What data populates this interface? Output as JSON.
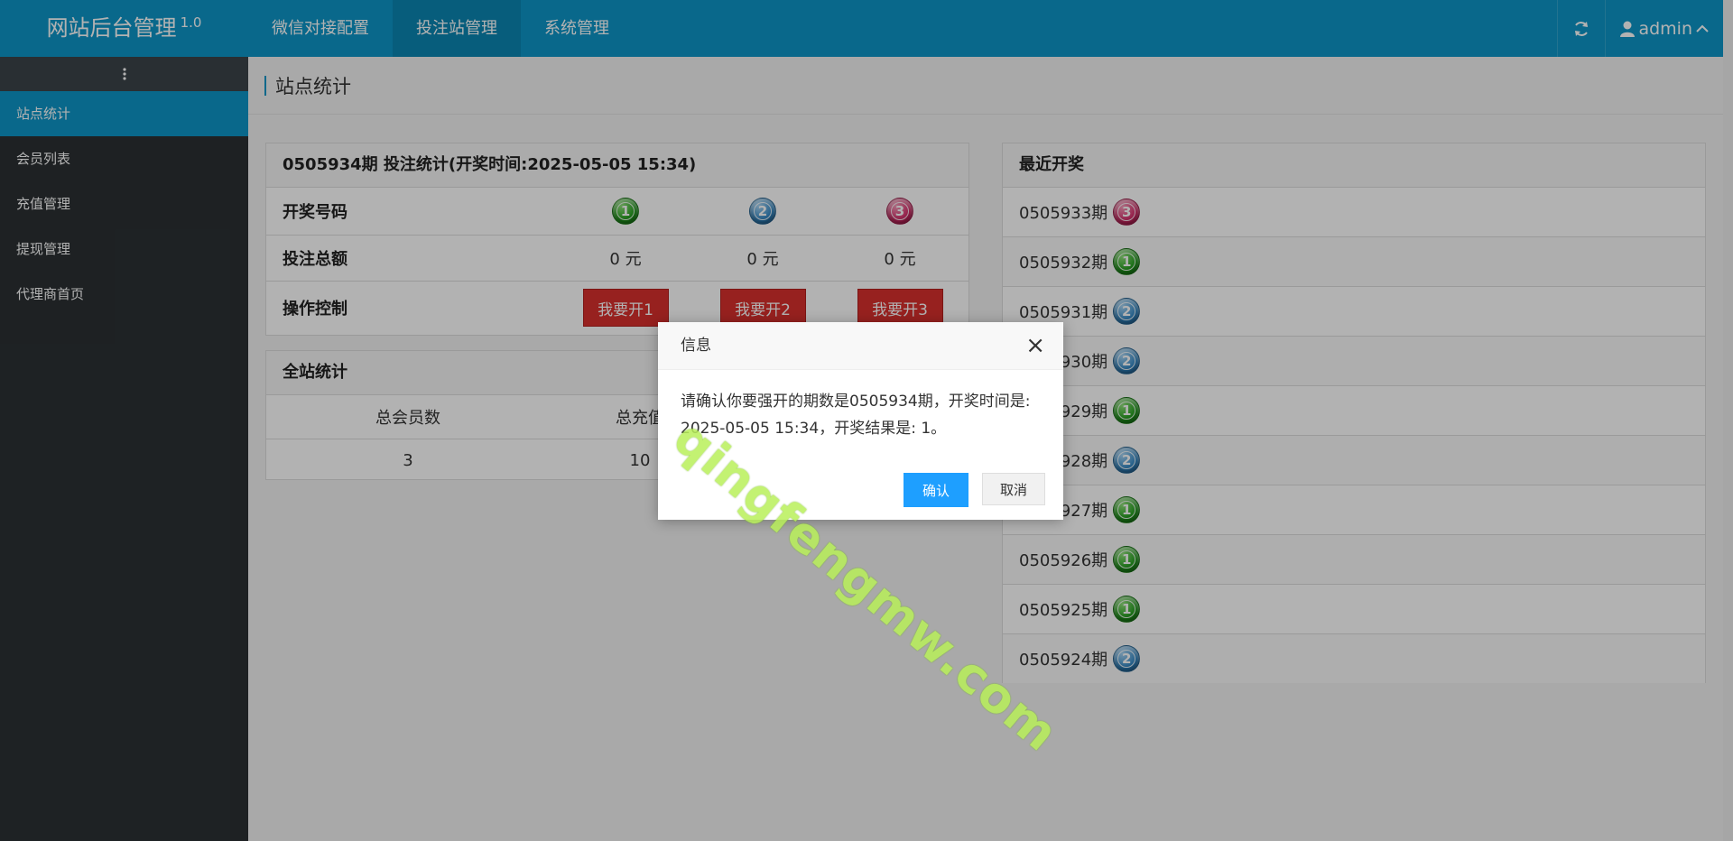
{
  "app": {
    "title": "网站后台管理",
    "version": "1.0"
  },
  "top_nav": [
    {
      "label": "微信对接配置",
      "active": false
    },
    {
      "label": "投注站管理",
      "active": true
    },
    {
      "label": "系统管理",
      "active": false
    }
  ],
  "user": {
    "name": "admin"
  },
  "sidebar": {
    "items": [
      {
        "label": "站点统计",
        "active": true
      },
      {
        "label": "会员列表",
        "active": false
      },
      {
        "label": "充值管理",
        "active": false
      },
      {
        "label": "提现管理",
        "active": false
      },
      {
        "label": "代理商首页",
        "active": false
      }
    ]
  },
  "page": {
    "title": "站点统计"
  },
  "bet_panel": {
    "title": "0505934期 投注统计(开奖时间:2025-05-05 15:34)",
    "draw_label": "开奖号码",
    "balls": [
      "1",
      "2",
      "3"
    ],
    "total_label": "投注总额",
    "totals": [
      "0 元",
      "0 元",
      "0 元"
    ],
    "control_label": "操作控制",
    "buttons": [
      "我要开1",
      "我要开2",
      "我要开3"
    ]
  },
  "site_stats": {
    "title": "全站统计",
    "headers": [
      "总会员数",
      "总充值"
    ],
    "values": [
      "3",
      "10"
    ]
  },
  "recent": {
    "title": "最近开奖",
    "draws": [
      {
        "period": "0505933期",
        "result": "3"
      },
      {
        "period": "0505932期",
        "result": "1"
      },
      {
        "period": "0505931期",
        "result": "2"
      },
      {
        "period": "0505930期",
        "result": "2"
      },
      {
        "period": "0505929期",
        "result": "1"
      },
      {
        "period": "0505928期",
        "result": "2"
      },
      {
        "period": "0505927期",
        "result": "1"
      },
      {
        "period": "0505926期",
        "result": "1"
      },
      {
        "period": "0505925期",
        "result": "1"
      },
      {
        "period": "0505924期",
        "result": "2"
      }
    ]
  },
  "dialog": {
    "title": "信息",
    "close": "×",
    "message_line1": "请确认你要强开的期数是0505934期，开奖时间是:",
    "message_line2": "2025-05-05 15:34，开奖结果是: 1。",
    "confirm": "确认",
    "cancel": "取消"
  },
  "watermark": "qingfengmw.com",
  "colors": {
    "primary": "#0e96c7",
    "sidebar": "#2b3033",
    "danger": "#d9302d",
    "confirm": "#1e9fff"
  }
}
